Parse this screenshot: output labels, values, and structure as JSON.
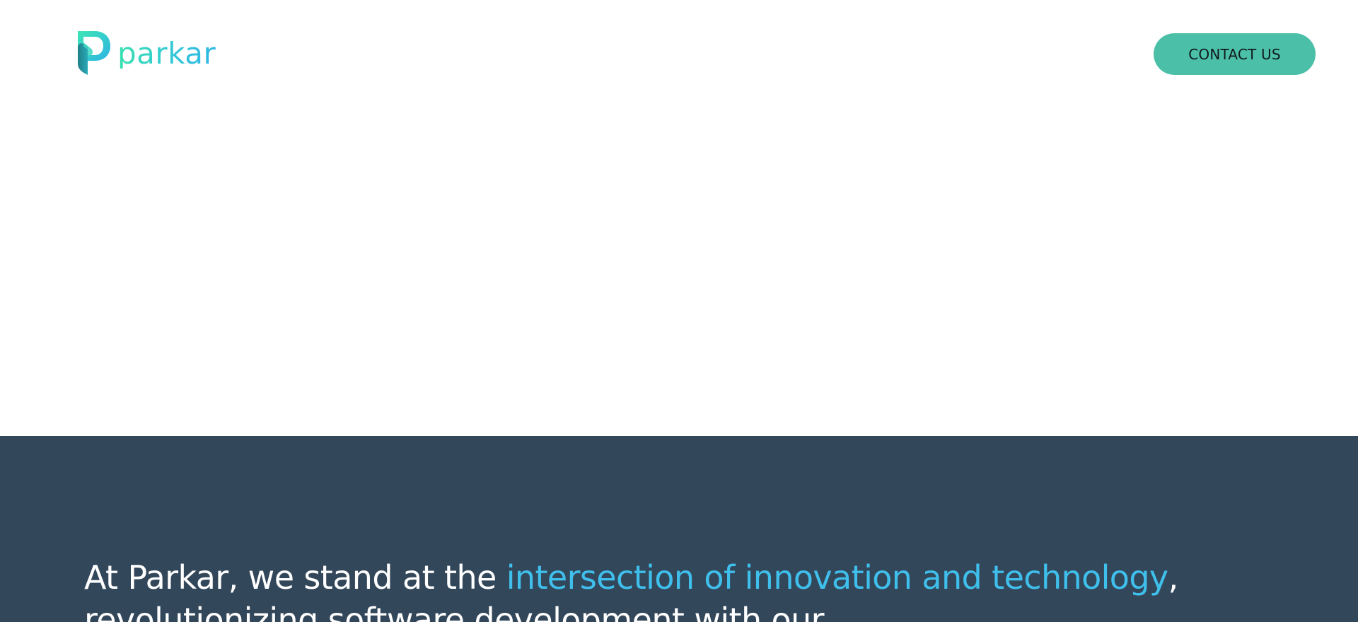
{
  "header": {
    "logo_text": "parkar",
    "contact_label": "CONTACT US"
  },
  "about": {
    "intro": "At Parkar, we stand at the ",
    "highlight": "intersection of innovation and technology",
    "rest": ", revolutionizing software development with our"
  },
  "colors": {
    "accent": "#4bbfa8",
    "highlight": "#3fc0ec",
    "section_bg": "#33475b",
    "logo_start": "#38e0b0",
    "logo_end": "#30b6e6"
  },
  "icons": {
    "logo_mark": "parkar-p-icon"
  }
}
